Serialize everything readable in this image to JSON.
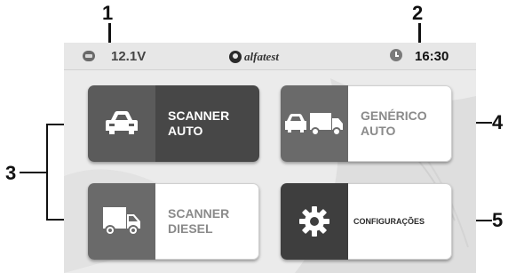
{
  "callouts": {
    "c1": "1",
    "c2": "2",
    "c3": "3",
    "c4": "4",
    "c5": "5"
  },
  "statusbar": {
    "voltage": "12.1V",
    "logo_text": "alfatest",
    "time": "16:30",
    "battery_icon": "battery-icon",
    "clock_icon": "clock-icon"
  },
  "tiles": [
    {
      "line1": "SCANNER",
      "line2": "AUTO",
      "icon": "car-icon",
      "style": "dark"
    },
    {
      "line1": "GENÉRICO",
      "line2": "AUTO",
      "icon": "car-truck-icon",
      "style": "light"
    },
    {
      "line1": "SCANNER",
      "line2": "DIESEL",
      "icon": "truck-icon",
      "style": "light"
    },
    {
      "line1": "CONFIGURAÇÕES",
      "line2": "",
      "icon": "gear-icon",
      "style": "light"
    }
  ],
  "colors": {
    "tile_dark": "#474747",
    "tile_icon": "#5b5b5b",
    "screen_bg": "#ececec"
  }
}
